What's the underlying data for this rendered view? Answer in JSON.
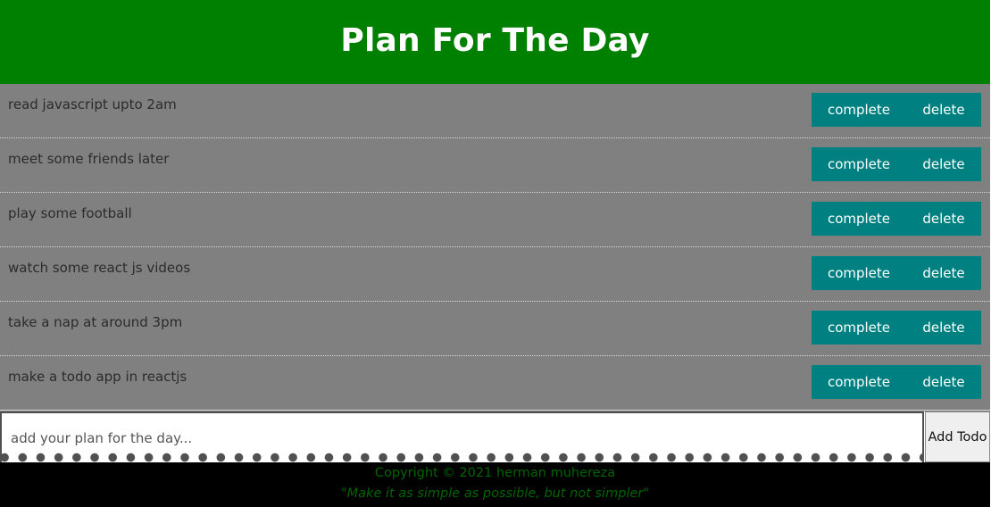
{
  "header": {
    "title": "Plan For The Day"
  },
  "todos": [
    {
      "text": "read javascript upto 2am",
      "complete_label": "complete",
      "delete_label": "delete"
    },
    {
      "text": "meet some friends later",
      "complete_label": "complete",
      "delete_label": "delete"
    },
    {
      "text": "play some football",
      "complete_label": "complete",
      "delete_label": "delete"
    },
    {
      "text": "watch some react js videos",
      "complete_label": "complete",
      "delete_label": "delete"
    },
    {
      "text": "take a nap at around 3pm",
      "complete_label": "complete",
      "delete_label": "delete"
    },
    {
      "text": "make a todo app in reactjs",
      "complete_label": "complete",
      "delete_label": "delete"
    }
  ],
  "form": {
    "input_value": "",
    "input_placeholder": "add your plan for the day...",
    "add_label": "Add Todo"
  },
  "footer": {
    "copyright": "Copyright © 2021 herman muhereza",
    "quote": "\"Make it as simple as possible, but not simpler\""
  },
  "colors": {
    "header_bg": "#008000",
    "list_bg": "#808080",
    "button_bg": "#008080",
    "footer_bg": "#000000",
    "footer_text": "#006400"
  }
}
